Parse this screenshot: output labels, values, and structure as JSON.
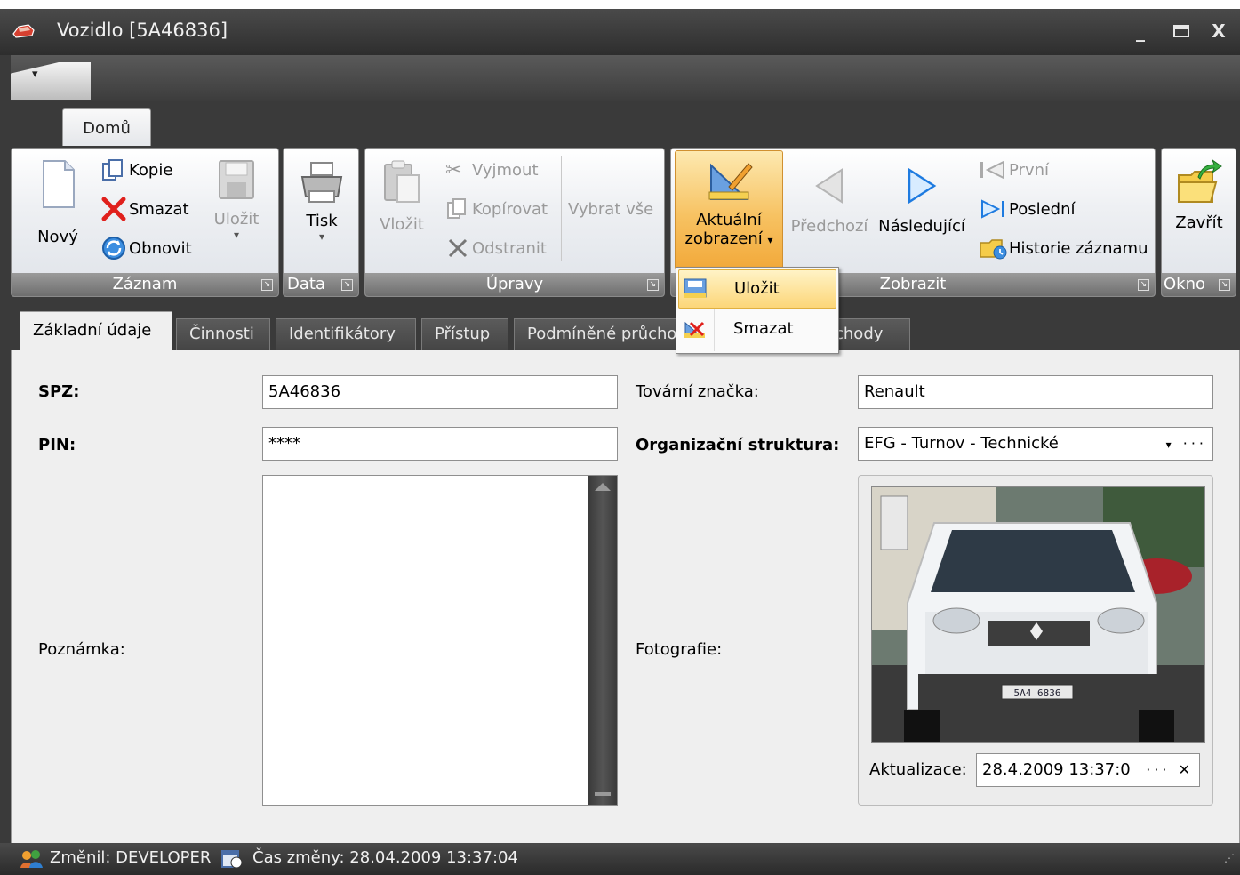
{
  "window": {
    "title": "Vozidlo [5A46836]",
    "minimize": "_",
    "maximize": "▭",
    "close": "X"
  },
  "ribbon": {
    "tab": "Domů",
    "groups": {
      "zaznam": {
        "label": "Záznam",
        "novy": "Nový",
        "kopie": "Kopie",
        "smazat": "Smazat",
        "obnovit": "Obnovit",
        "ulozit": "Uložit"
      },
      "data": {
        "label": "Data",
        "tisk": "Tisk"
      },
      "upravy": {
        "label": "Úpravy",
        "vlozit": "Vložit",
        "vyjmout": "Vyjmout",
        "kopirovat": "Kopírovat",
        "odstranit": "Odstranit",
        "vybrat_vse": "Vybrat vše"
      },
      "zobrazit": {
        "label": "Zobrazit",
        "aktualni_1": "Aktuální",
        "aktualni_2": "zobrazení",
        "predchozi": "Předchozí",
        "nasledujici": "Následující",
        "prvni": "První",
        "posledni": "Poslední",
        "historie": "Historie záznamu"
      },
      "okno": {
        "label": "Okno",
        "zavrit": "Zavřít"
      }
    }
  },
  "dropdown_menu": {
    "items": [
      {
        "label": "Uložit"
      },
      {
        "label": "Smazat"
      }
    ]
  },
  "tabs": [
    {
      "label": "Základní údaje"
    },
    {
      "label": "Činnosti"
    },
    {
      "label": "Identifikátory"
    },
    {
      "label": "Přístup"
    },
    {
      "label": "Podmíněné průcho"
    },
    {
      "label": "chody"
    }
  ],
  "form": {
    "spz_label": "SPZ:",
    "spz_value": "5A46836",
    "pin_label": "PIN:",
    "pin_value": "****",
    "poznamka_label": "Poznámka:",
    "tovarni_label": "Tovární značka:",
    "tovarni_value": "Renault",
    "org_label": "Organizační struktura:",
    "org_value": "EFG - Turnov - Technické",
    "foto_label": "Fotografie:",
    "aktualizace_label": "Aktualizace:",
    "aktualizace_value": "28.4.2009 13:37:0",
    "plate_text": "5A4 6836"
  },
  "status": {
    "zmenil": "Změnil: DEVELOPER",
    "cas": "Čas změny: 28.04.2009 13:37:04"
  }
}
